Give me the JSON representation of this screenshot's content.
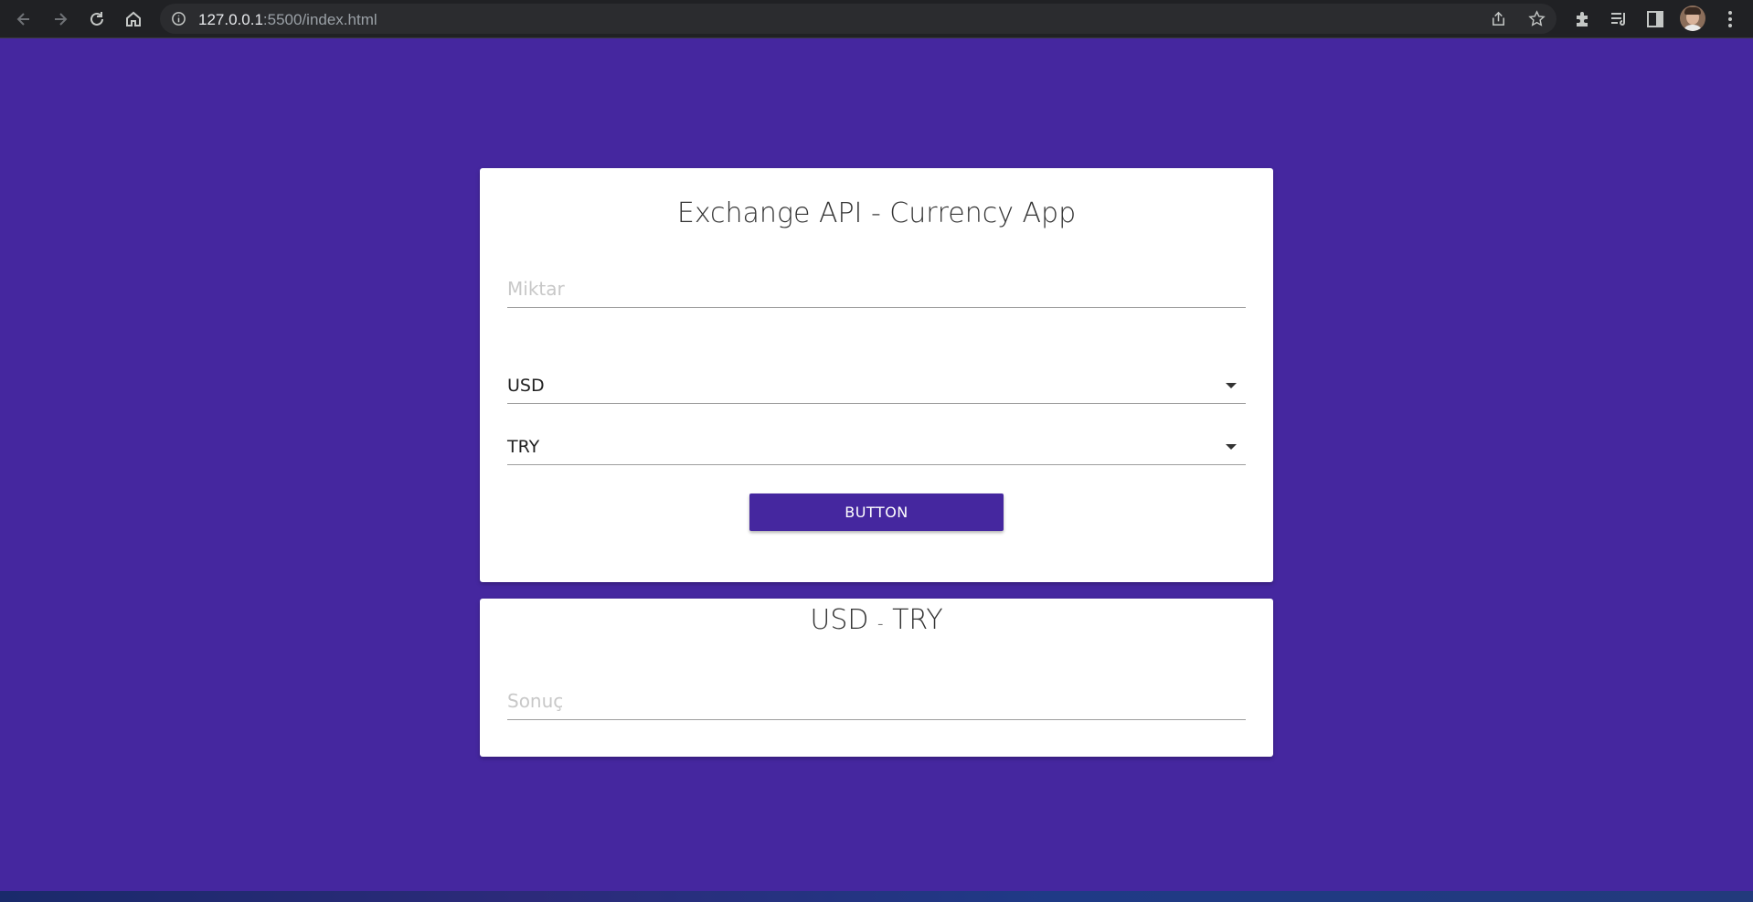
{
  "browser": {
    "url_host": "127.0.0.1",
    "url_rest": ":5500/index.html"
  },
  "main_card": {
    "title": "Exchange API - Currency App",
    "amount_placeholder": "Miktar",
    "from_currency": "USD",
    "to_currency": "TRY",
    "button_label": "BUTTON"
  },
  "result_card": {
    "title_from": "USD",
    "title_sep": "-",
    "title_to": "TRY",
    "result_placeholder": "Sonuç"
  },
  "colors": {
    "background": "#45279f",
    "button": "#45279f"
  }
}
